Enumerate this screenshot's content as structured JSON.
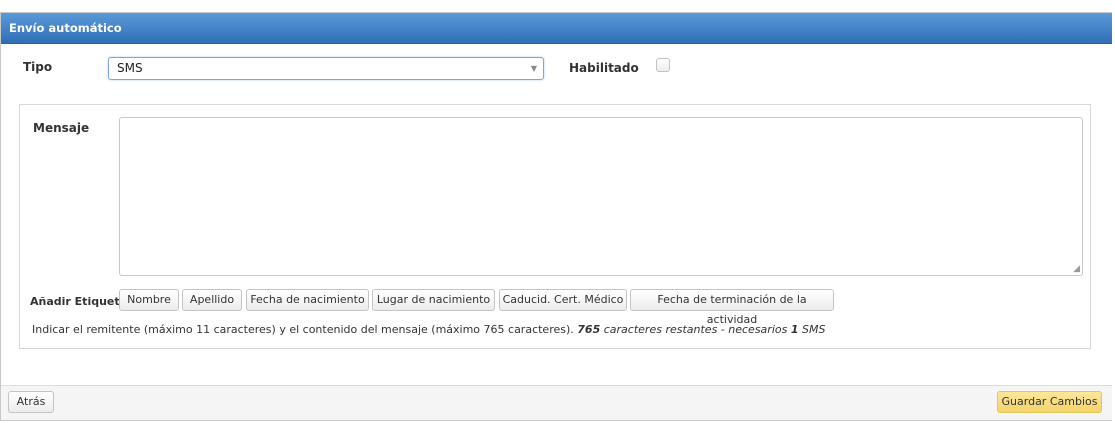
{
  "panel": {
    "title": "Envío automático"
  },
  "form": {
    "tipo_label": "Tipo",
    "tipo_value": "SMS",
    "habilitado_label": "Habilitado",
    "habilitado_checked": false
  },
  "message": {
    "label": "Mensaje",
    "value": "",
    "tags_label": "Añadir Etiquetas:",
    "tags": [
      "Nombre",
      "Apellido",
      "Fecha de nacimiento",
      "Lugar de nacimiento",
      "Caducid. Cert. Médico",
      "Fecha de terminación de la actividad"
    ],
    "info_text": "Indicar el remitente (máximo 11 caracteres) y el contenido del mensaje (máximo 765 caracteres).",
    "remaining_count": "765",
    "remaining_text": "caracteres restantes - necesarios",
    "sms_count": "1",
    "sms_label": "SMS"
  },
  "footer": {
    "back_label": "Atrás",
    "save_label": "Guardar Cambios"
  },
  "colors": {
    "header": "#3a7cc4",
    "save_button": "#f8dc82"
  }
}
